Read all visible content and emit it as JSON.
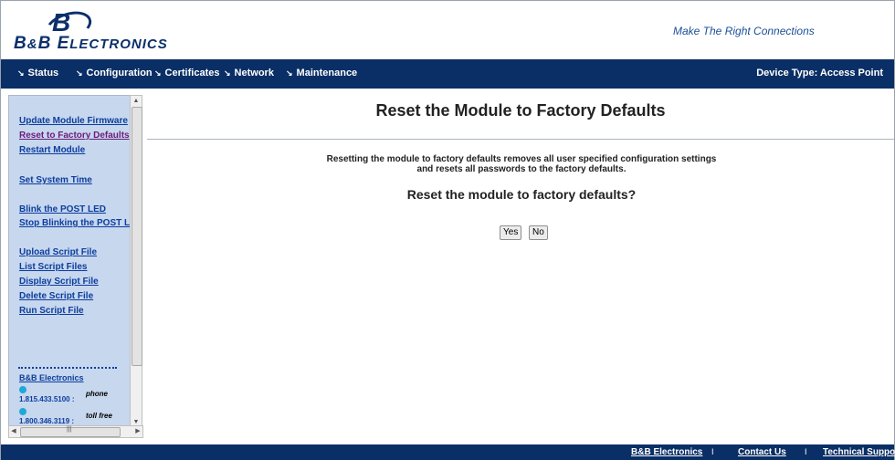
{
  "header": {
    "logo_text_big1": "B",
    "logo_text_amp": "&",
    "logo_text_big2": "B ",
    "logo_text_e": "E",
    "logo_text_rest": "LECTRONICS",
    "logo_mark": "B",
    "tagline": "Make The Right Connections"
  },
  "nav": {
    "items": [
      {
        "label": "Status",
        "arrow": "↘"
      },
      {
        "label": "Configuration",
        "arrow": "↘"
      },
      {
        "label": "Certificates",
        "arrow": "↘"
      },
      {
        "label": "Network",
        "arrow": "↘"
      },
      {
        "label": "Maintenance",
        "arrow": "↘"
      }
    ],
    "device_type": "Device Type: Access Point"
  },
  "sidebar": {
    "links": [
      {
        "label": "Update Module Firmware"
      },
      {
        "label": "Reset to Factory Defaults"
      },
      {
        "label": "Restart Module"
      },
      {
        "label": "Set System Time"
      },
      {
        "label": "Blink the POST LED"
      },
      {
        "label": "Stop Blinking the POST LED"
      },
      {
        "label": "Upload Script File"
      },
      {
        "label": "List Script Files"
      },
      {
        "label": "Display Script File"
      },
      {
        "label": "Delete Script File"
      },
      {
        "label": "Run Script File"
      }
    ],
    "company": "B&B Electronics",
    "phones": [
      {
        "number": "1.815.433.5100",
        "colon": ":",
        "label": "phone"
      },
      {
        "number": "1.800.346.3119",
        "colon": ":",
        "label": "toll free"
      }
    ]
  },
  "main": {
    "title": "Reset the Module to Factory Defaults",
    "description_line1": "Resetting the module to factory defaults removes all user specified configuration settings",
    "description_line2": "and resets all passwords to the factory defaults.",
    "question": "Reset the module to factory defaults?",
    "yes_label": "Yes",
    "no_label": "No"
  },
  "footer": {
    "links": [
      "B&B Electronics",
      "Contact Us",
      "Technical Support"
    ],
    "separator": "I"
  },
  "colors": {
    "nav_bg": "#0a2f66",
    "sidebar_bg": "#c7d7ee",
    "link": "#0c3d9e",
    "visited_link": "#6a1b7c"
  }
}
